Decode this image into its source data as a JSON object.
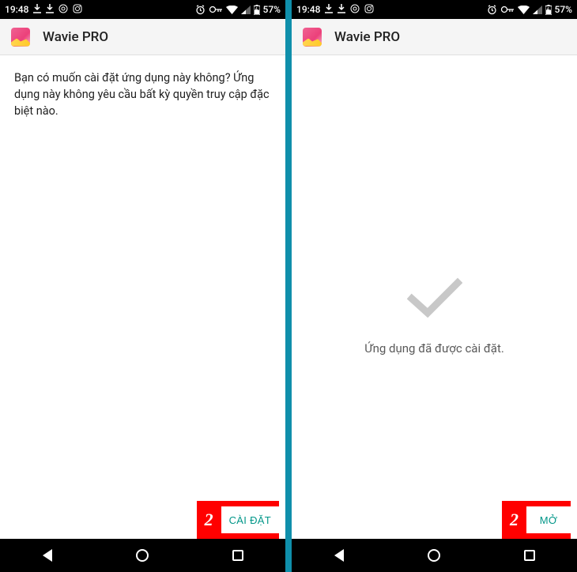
{
  "status": {
    "time": "19:48",
    "battery": "57%"
  },
  "app": {
    "title": "Wavie PRO",
    "icon": "wavie-app-icon"
  },
  "left": {
    "prompt": "Bạn có muốn cài đặt ứng dụng này không? Ứng dụng này không yêu cầu bất kỳ quyền truy cập đặc biệt nào.",
    "step": "2",
    "action_label": "CÀI ĐẶT"
  },
  "right": {
    "done_text": "Ứng dụng đã được cài đặt.",
    "step": "2",
    "action_label": "MỞ"
  }
}
